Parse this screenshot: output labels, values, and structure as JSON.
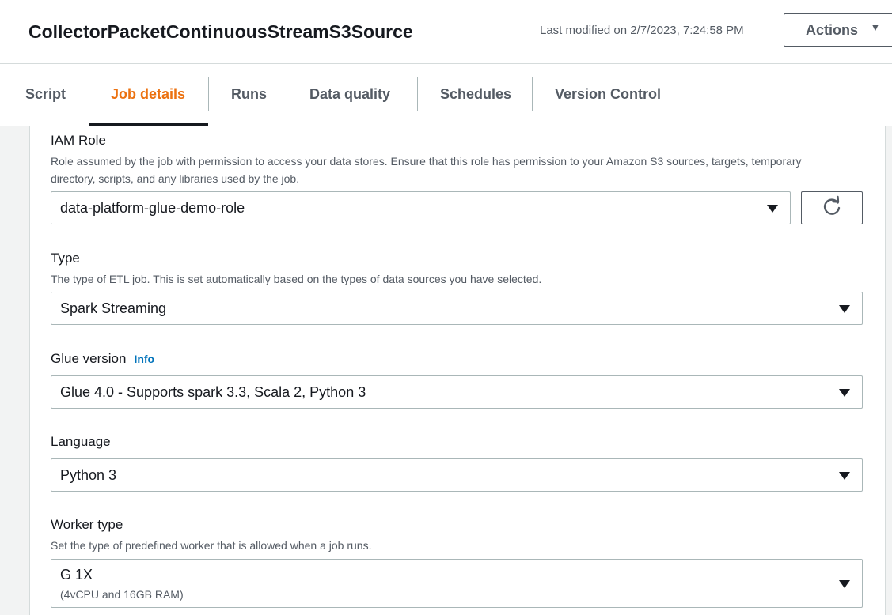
{
  "header": {
    "title": "CollectorPacketContinuousStreamS3Source",
    "last_modified": "Last modified on 2/7/2023, 7:24:58 PM",
    "actions_label": "Actions"
  },
  "tabs": [
    {
      "label": "Script",
      "active": false
    },
    {
      "label": "Job details",
      "active": true
    },
    {
      "label": "Runs",
      "active": false
    },
    {
      "label": "Data quality",
      "active": false
    },
    {
      "label": "Schedules",
      "active": false
    },
    {
      "label": "Version Control",
      "active": false
    }
  ],
  "form": {
    "iam_role": {
      "label": "IAM Role",
      "description": "Role assumed by the job with permission to access your data stores. Ensure that this role has permission to your Amazon S3 sources, targets, temporary directory, scripts, and any libraries used by the job.",
      "value": "data-platform-glue-demo-role"
    },
    "type": {
      "label": "Type",
      "description": "The type of ETL job. This is set automatically based on the types of data sources you have selected.",
      "value": "Spark Streaming"
    },
    "glue_version": {
      "label": "Glue version",
      "info": "Info",
      "value": "Glue 4.0 - Supports spark 3.3, Scala 2, Python 3"
    },
    "language": {
      "label": "Language",
      "value": "Python 3"
    },
    "worker_type": {
      "label": "Worker type",
      "description": "Set the type of predefined worker that is allowed when a job runs.",
      "value": "G 1X",
      "sub": "(4vCPU and 16GB RAM)"
    }
  },
  "colors": {
    "accent": "#ec7211",
    "link": "#0073bb",
    "text": "#16191f",
    "secondary_text": "#545b64",
    "border": "#aab7b8"
  },
  "icons": {
    "actions_caret": "caret-down-icon",
    "refresh": "refresh-icon",
    "select_caret": "caret-down-icon"
  }
}
